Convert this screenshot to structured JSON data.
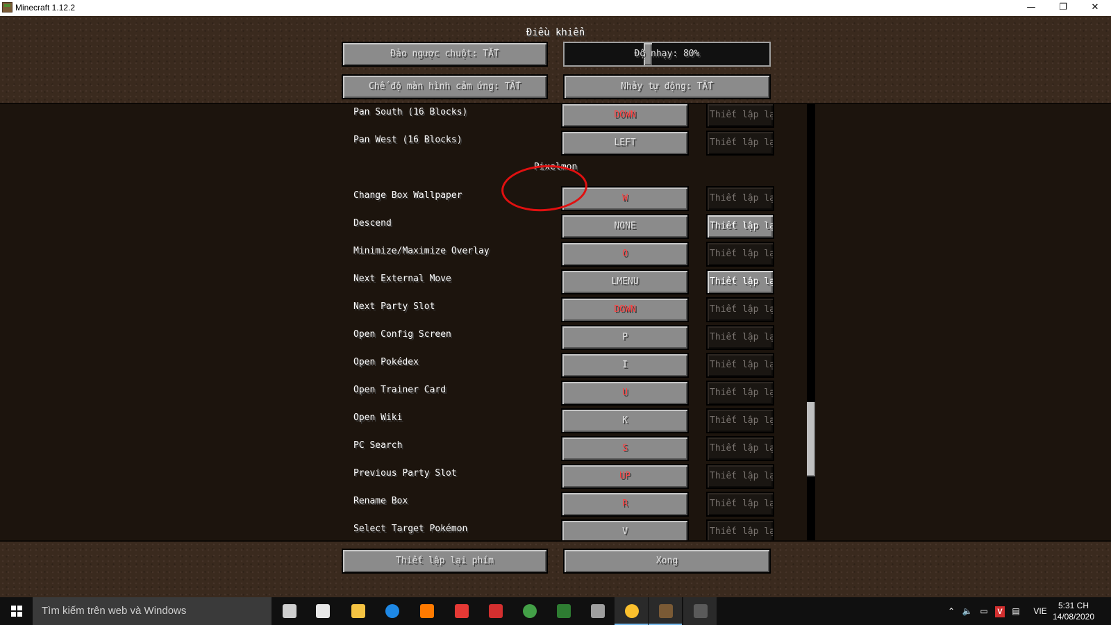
{
  "window": {
    "title": "Minecraft 1.12.2",
    "controls": {
      "minimize": "—",
      "restore": "❐",
      "close": "✕"
    }
  },
  "screen": {
    "title": "Điều khiển",
    "top_buttons": {
      "invert_mouse": "Đảo ngược chuột: TẮT",
      "sensitivity": "Độ nhạy: 80%",
      "sensitivity_value": 0.8,
      "touchscreen": "Chế độ màn hình cảm ứng: TẮT",
      "auto_jump": "Nhảy tự động: TẮT"
    },
    "reset_label": "Thiết lập lại",
    "category_pixelmon": "Pixelmon",
    "rows_top": [
      {
        "label": "Pan South (16 Blocks)",
        "key": "DOWN",
        "conflict": true,
        "reset_active": false
      },
      {
        "label": "Pan West (16 Blocks)",
        "key": "LEFT",
        "conflict": false,
        "reset_active": false
      }
    ],
    "rows_pixelmon": [
      {
        "label": "Change Box Wallpaper",
        "key": "W",
        "conflict": true,
        "reset_active": false
      },
      {
        "label": "Descend",
        "key": "NONE",
        "conflict": false,
        "reset_active": true
      },
      {
        "label": "Minimize/Maximize Overlay",
        "key": "O",
        "conflict": true,
        "reset_active": false
      },
      {
        "label": "Next External Move",
        "key": "LMENU",
        "conflict": false,
        "reset_active": true
      },
      {
        "label": "Next Party Slot",
        "key": "DOWN",
        "conflict": true,
        "reset_active": false
      },
      {
        "label": "Open Config Screen",
        "key": "P",
        "conflict": false,
        "reset_active": false
      },
      {
        "label": "Open Pokédex",
        "key": "I",
        "conflict": false,
        "reset_active": false
      },
      {
        "label": "Open Trainer Card",
        "key": "U",
        "conflict": true,
        "reset_active": false
      },
      {
        "label": "Open Wiki",
        "key": "K",
        "conflict": false,
        "reset_active": false
      },
      {
        "label": "PC Search",
        "key": "S",
        "conflict": true,
        "reset_active": false
      },
      {
        "label": "Previous Party Slot",
        "key": "UP",
        "conflict": true,
        "reset_active": false
      },
      {
        "label": "Rename Box",
        "key": "R",
        "conflict": true,
        "reset_active": false
      },
      {
        "label": "Select Target Pokémon",
        "key": "V",
        "conflict": false,
        "reset_active": false
      }
    ],
    "bottom_buttons": {
      "reset_keys": "Thiết lập lại phím",
      "done": "Xong"
    }
  },
  "taskbar": {
    "search_placeholder": "Tìm kiếm trên web và Windows",
    "apps": [
      {
        "name": "task-view-icon",
        "color": "#cfcfcf"
      },
      {
        "name": "store-icon",
        "color": "#e8e8e8"
      },
      {
        "name": "file-explorer-icon",
        "color": "#f5c342"
      },
      {
        "name": "edge-icon",
        "color": "#1e88e5"
      },
      {
        "name": "avast-icon",
        "color": "#ff7a00"
      },
      {
        "name": "ccleaner-icon",
        "color": "#e53935"
      },
      {
        "name": "ultraviewer-icon",
        "color": "#d32f2f"
      },
      {
        "name": "chrome-icon",
        "color": "#43a047"
      },
      {
        "name": "coccoc-icon",
        "color": "#2e7d32"
      },
      {
        "name": "calculator-icon",
        "color": "#9e9e9e"
      },
      {
        "name": "chrome-running-icon",
        "color": "#fbc02d"
      },
      {
        "name": "minecraft-icon",
        "color": "#7a5a35"
      },
      {
        "name": "terminal-icon",
        "color": "#5a5a5a"
      }
    ],
    "tray": {
      "language": "VIE",
      "time": "5:31 CH",
      "date": "14/08/2020"
    }
  },
  "colors": {
    "conflict": "#ff3f3f",
    "button": "#8b8b8b",
    "annotation": "#e01010"
  }
}
